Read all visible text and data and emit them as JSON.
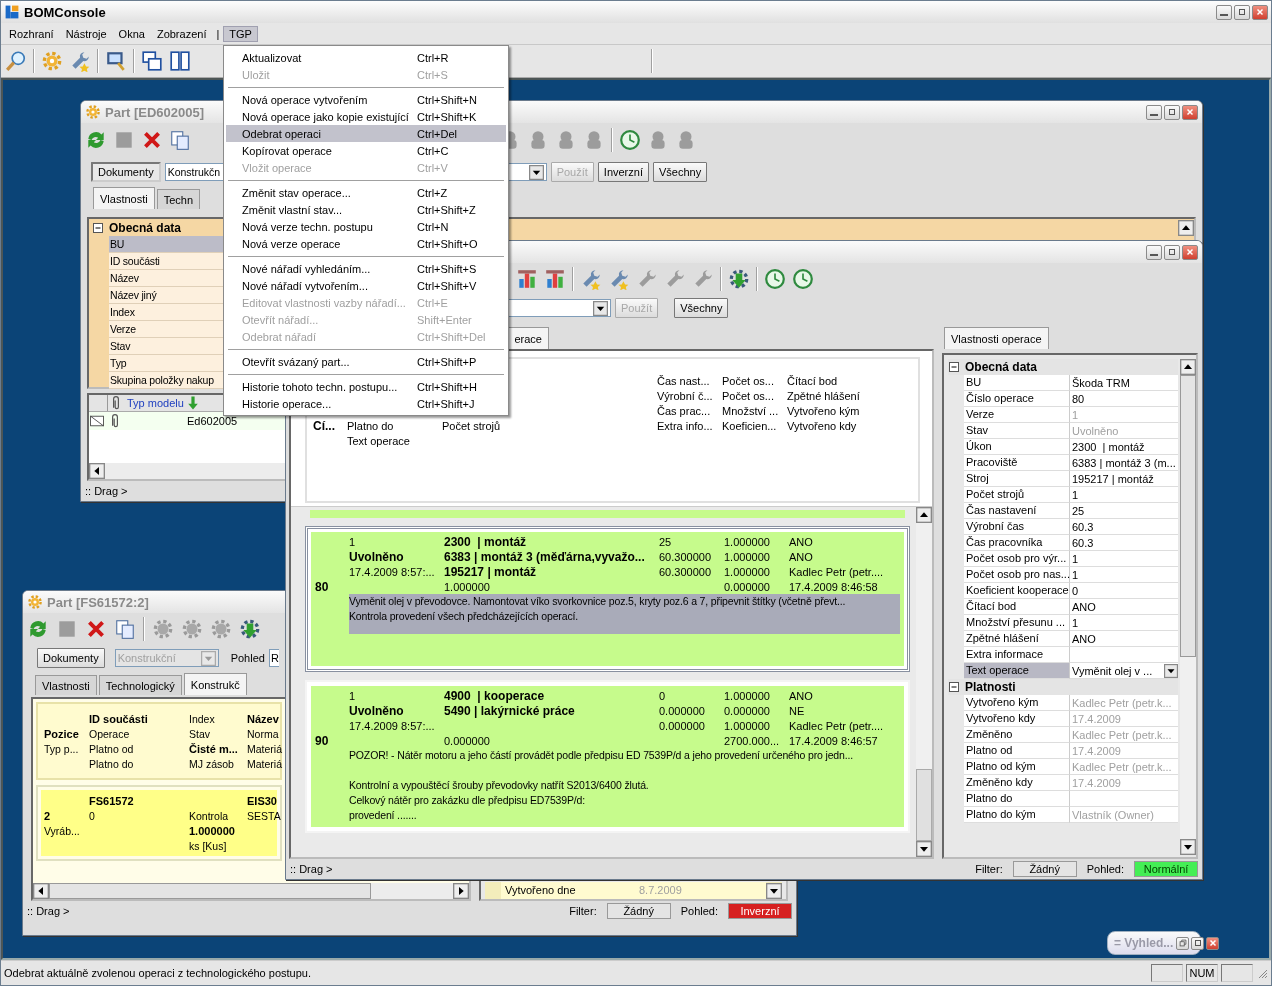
{
  "app": {
    "title": "BOMConsole"
  },
  "menu_bar": [
    {
      "label": "Rozhraní",
      "kind": "menu",
      "selected": false
    },
    {
      "label": "Nástroje",
      "kind": "menu",
      "selected": false
    },
    {
      "label": "Okna",
      "kind": "menu",
      "selected": false
    },
    {
      "label": "Zobrazení",
      "kind": "menu",
      "selected": false
    },
    {
      "label": "|",
      "kind": "divider"
    },
    {
      "label": "TGP",
      "kind": "menu",
      "selected": true
    }
  ],
  "tgp_menu": [
    [
      {
        "label": "Aktualizovat",
        "shortcut": "Ctrl+R",
        "disabled": false,
        "selected": false
      },
      {
        "label": "Uložit",
        "shortcut": "Ctrl+S",
        "disabled": true,
        "selected": false
      }
    ],
    [
      {
        "label": "Nová operace vytvořením",
        "shortcut": "Ctrl+Shift+N",
        "disabled": false,
        "selected": false
      },
      {
        "label": "Nová operace jako kopie existující",
        "shortcut": "Ctrl+Shift+K",
        "disabled": false,
        "selected": false
      },
      {
        "label": "Odebrat operaci",
        "shortcut": "Ctrl+Del",
        "disabled": false,
        "selected": true
      },
      {
        "label": "Kopírovat operace",
        "shortcut": "Ctrl+C",
        "disabled": false,
        "selected": false
      },
      {
        "label": "Vložit operace",
        "shortcut": "Ctrl+V",
        "disabled": true,
        "selected": false
      }
    ],
    [
      {
        "label": "Změnit stav operace...",
        "shortcut": "Ctrl+Z",
        "disabled": false,
        "selected": false
      },
      {
        "label": "Změnit vlastní stav...",
        "shortcut": "Ctrl+Shift+Z",
        "disabled": false,
        "selected": false
      },
      {
        "label": "Nová verze techn. postupu",
        "shortcut": "Ctrl+N",
        "disabled": false,
        "selected": false
      },
      {
        "label": "Nová verze operace",
        "shortcut": "Ctrl+Shift+O",
        "disabled": false,
        "selected": false
      }
    ],
    [
      {
        "label": "Nové nářadí vyhledáním...",
        "shortcut": "Ctrl+Shift+S",
        "disabled": false,
        "selected": false
      },
      {
        "label": "Nové nářadí vytvořením...",
        "shortcut": "Ctrl+Shift+V",
        "disabled": false,
        "selected": false
      },
      {
        "label": "Editovat vlastnosti vazby nářadí...",
        "shortcut": "Ctrl+E",
        "disabled": true,
        "selected": false
      },
      {
        "label": "Otevřít nářadí...",
        "shortcut": "Shift+Enter",
        "disabled": true,
        "selected": false
      },
      {
        "label": "Odebrat nářadí",
        "shortcut": "Ctrl+Shift+Del",
        "disabled": true,
        "selected": false
      }
    ],
    [
      {
        "label": "Otevřít svázaný part...",
        "shortcut": "Ctrl+Shift+P",
        "disabled": false,
        "selected": false
      }
    ],
    [
      {
        "label": "Historie tohoto techn. postupu...",
        "shortcut": "Ctrl+Shift+H",
        "disabled": false,
        "selected": false
      },
      {
        "label": "Historie operace...",
        "shortcut": "Ctrl+Shift+J",
        "disabled": false,
        "selected": false
      }
    ]
  ],
  "part_window_ed602005": {
    "title": "Part [ED602005]",
    "documents_button": "Dokumenty",
    "structure_combo": "Konstrukčn",
    "apply_button": {
      "label": "Použít",
      "disabled": true
    },
    "inverse_button": "Inverzní",
    "all_button": "Všechny",
    "tabs": [
      {
        "label": "Vlastnosti",
        "selected": true
      },
      {
        "label": "Techn",
        "selected": false
      }
    ],
    "properties": {
      "sections": [
        {
          "title": "Obecná data",
          "expanded": true,
          "rows": [
            {
              "label": "BU",
              "selected": true
            },
            {
              "label": "ID součásti",
              "selected": false
            },
            {
              "label": "Název",
              "selected": false
            },
            {
              "label": "Název jiný",
              "selected": false
            },
            {
              "label": "Index",
              "selected": false
            },
            {
              "label": "Verze",
              "selected": false
            },
            {
              "label": "Stav",
              "selected": false
            },
            {
              "label": "Typ",
              "selected": false
            },
            {
              "label": "Skupina položky nakup",
              "selected": false
            }
          ]
        }
      ]
    },
    "models": {
      "columns": [
        "Typ modelu"
      ],
      "rows": [
        {
          "model": "Ed602005"
        }
      ]
    },
    "status": {
      "drag": ":: Drag >"
    }
  },
  "operations_window": {
    "apply_button": {
      "label": "Použít",
      "disabled": true
    },
    "all_button": "Všechny",
    "tabs": [
      {
        "label": "erace",
        "selected": true
      }
    ],
    "header": {
      "lines": [
        {
          "column_4": "Čas nast...",
          "column_5": "Počet os...",
          "column_6": "Čítací bod"
        },
        {
          "column_4": "Výrobní č...",
          "column_5": "Počet os...",
          "column_6": "Zpětné hlášení"
        },
        {
          "column_4": "Čas prac...",
          "column_5": "Množství ...",
          "column_6": "Vytvořeno kým"
        },
        {
          "column_1": {
            "text": "Cí...",
            "bold": true
          },
          "column_2": "Platno do",
          "column_3": "Počet strojů",
          "column_4": "Extra info...",
          "column_5": "Koeficien...",
          "column_6": "Vytvořeno kdy"
        }
      ],
      "text_label": "Text operace"
    },
    "operations": [
      {
        "selected": true,
        "lines": [
          {
            "column_2": "1",
            "column_3": {
              "text": "2300  | montáž",
              "bold": true
            },
            "column_4": "25",
            "column_5": "1.000000",
            "column_6": "ANO"
          },
          {
            "column_2": {
              "text": "Uvolněno",
              "bold": true
            },
            "column_3": {
              "text": "6383 | montáž 3 (měďárna,vyvažo...",
              "bold": true
            },
            "column_4": "60.300000",
            "column_5": "1.000000",
            "column_6": "ANO"
          },
          {
            "column_2": "17.4.2009 8:57:...",
            "column_3": {
              "text": "195217 | montáž",
              "bold": true
            },
            "column_4": "60.300000",
            "column_5": "1.000000",
            "column_6": "Kadlec Petr (petr...."
          },
          {
            "column_1": {
              "text": "80",
              "bold": true
            },
            "column_3": "1.000000",
            "column_5": "0.000000",
            "column_6": "17.4.2009 8:46:58"
          }
        ],
        "text": [
          [
            "Vyměnit olej v převodovce. Namontovat víko svorkovnice poz.5, kryty poz.6 a 7, připevnit štítky (včetně převt...",
            "Kontrola provedení všech předcházejících operací."
          ]
        ]
      },
      {
        "selected": false,
        "lines": [
          {
            "column_2": "1",
            "column_3": {
              "text": "4900  | kooperace",
              "bold": true
            },
            "column_4": "0",
            "column_5": "1.000000",
            "column_6": "ANO"
          },
          {
            "column_2": {
              "text": "Uvolněno",
              "bold": true
            },
            "column_3": {
              "text": "5490 | lakýrnické práce",
              "bold": true
            },
            "column_4": "0.000000",
            "column_5": "0.000000",
            "column_6": "NE"
          },
          {
            "column_2": "17.4.2009 8:57:...",
            "column_4": "0.000000",
            "column_5": "1.000000",
            "column_6": "Kadlec Petr (petr...."
          },
          {
            "column_1": {
              "text": "90",
              "bold": true
            },
            "column_3": "0.000000",
            "column_5": "2700.000...",
            "column_6": "17.4.2009 8:46:57"
          }
        ],
        "text": [
          [
            "POZOR! - Nátěr motoru a jeho částí provádět podle předpisu ED 7539P/d a jeho provedení určeného pro jedn..."
          ],
          [
            "Kontrolní a vypouštěcí šrouby převodovky natřít S2013/6400 žlutá.",
            "Celkový nátěr pro zakázku dle předpisu ED7539P/d:",
            "provedení ......."
          ]
        ]
      }
    ],
    "properties_tab": {
      "label": "Vlastnosti operace",
      "selected": true
    },
    "properties": {
      "sections": [
        {
          "title": "Obecná data",
          "expanded": true,
          "rows": [
            {
              "label": "BU",
              "value": "Škoda TRM",
              "disabled": false,
              "selected": false
            },
            {
              "label": "Číslo operace",
              "value": "80",
              "disabled": false,
              "selected": false
            },
            {
              "label": "Verze",
              "value": "1",
              "disabled": true,
              "selected": false
            },
            {
              "label": "Stav",
              "value": "Uvolněno",
              "disabled": true,
              "selected": false
            },
            {
              "label": "Úkon",
              "value": "2300  | montáž",
              "disabled": false,
              "selected": false
            },
            {
              "label": "Pracoviště",
              "value": "6383 | montáž 3 (m...",
              "disabled": false,
              "selected": false
            },
            {
              "label": "Stroj",
              "value": "195217 | montáž",
              "disabled": false,
              "selected": false
            },
            {
              "label": "Počet strojů",
              "value": "1",
              "disabled": false,
              "selected": false
            },
            {
              "label": "Čas nastavení",
              "value": "25",
              "disabled": false,
              "selected": false
            },
            {
              "label": "Výrobní čas",
              "value": "60.3",
              "disabled": false,
              "selected": false
            },
            {
              "label": "Čas pracovníka",
              "value": "60.3",
              "disabled": false,
              "selected": false
            },
            {
              "label": "Počet osob pro výr...",
              "value": "1",
              "disabled": false,
              "selected": false
            },
            {
              "label": "Počet osob pro nas...",
              "value": "1",
              "disabled": false,
              "selected": false
            },
            {
              "label": "Koeficient kooperace",
              "value": "0",
              "disabled": false,
              "selected": false
            },
            {
              "label": "Čítací bod",
              "value": "ANO",
              "disabled": false,
              "selected": false
            },
            {
              "label": "Množství přesunu ...",
              "value": "1",
              "disabled": false,
              "selected": false
            },
            {
              "label": "Zpětné hlášení",
              "value": "ANO",
              "disabled": false,
              "selected": false
            },
            {
              "label": "Extra informace",
              "selected": false
            },
            {
              "label": "Text operace",
              "value": "Vyměnit olej v ...",
              "kind": "dropdown",
              "disabled": false,
              "selected": true
            }
          ]
        },
        {
          "title": "Platnosti",
          "expanded": true,
          "rows": [
            {
              "label": "Vytvořeno kým",
              "value": "Kadlec Petr (petr.k...",
              "disabled": true,
              "selected": false
            },
            {
              "label": "Vytvořeno kdy",
              "value": "17.4.2009",
              "disabled": true,
              "selected": false
            },
            {
              "label": "Změněno",
              "value": "Kadlec Petr (petr.k...",
              "disabled": true,
              "selected": false
            },
            {
              "label": "Platno od",
              "value": "17.4.2009",
              "disabled": true,
              "selected": false
            },
            {
              "label": "Platno od kým",
              "value": "Kadlec Petr (petr.k...",
              "disabled": true,
              "selected": false
            },
            {
              "label": "Změněno kdy",
              "value": "17.4.2009",
              "disabled": true,
              "selected": false
            },
            {
              "label": "Platno do",
              "selected": false
            },
            {
              "label": "Platno do kým",
              "value": "Vlastník (Owner)",
              "disabled": true,
              "selected": false
            }
          ]
        }
      ]
    },
    "status": {
      "drag": ":: Drag >",
      "filter_label": "Filter:",
      "filter": "Žádný",
      "view_label": "Pohled:",
      "view": {
        "label": "Normální",
        "kind": "normal"
      }
    }
  },
  "part_window_fs61572": {
    "title": "Part [FS61572:2]",
    "documents_button": "Dokumenty",
    "structure_combo": {
      "value": "Konstrukční",
      "disabled": true
    },
    "view_label": "Pohled",
    "view_combo": "R",
    "tabs": [
      {
        "label": "Vlastnosti",
        "selected": false
      },
      {
        "label": "Technologický",
        "selected": false
      },
      {
        "label": "Konstrukč",
        "selected": true
      }
    ],
    "header": {
      "lines": [
        {
          "column_2": {
            "text": "ID součásti",
            "bold": true
          },
          "column_3": "Index",
          "column_4": {
            "text": "Název",
            "bold": true
          }
        },
        {
          "column_1": {
            "text": "Pozice",
            "bold": true
          },
          "column_2": "Operace",
          "column_3": "Stav",
          "column_4": "Norma"
        },
        {
          "column_1": "Typ p...",
          "column_2": "Platno od",
          "column_3": {
            "text": "Čisté m...",
            "bold": true
          },
          "column_4": "Materiá"
        },
        {
          "column_2": "Platno do",
          "column_3": "MJ zásob",
          "column_4": "Materiá"
        }
      ]
    },
    "items": [
      {
        "lines": [
          {
            "column_2": {
              "text": "FS61572",
              "bold": true
            },
            "column_4": {
              "text": "EIS30",
              "bold": true
            }
          },
          {
            "column_1": {
              "text": "2",
              "bold": true
            },
            "column_2": "0",
            "column_3": "Kontrola",
            "column_4": "SESTA"
          },
          {
            "column_1": "Vyráb...",
            "column_3": {
              "text": "1.000000",
              "bold": true
            }
          },
          {
            "column_3": "ks [Kus]"
          }
        ]
      }
    ],
    "details_row": {
      "label": "Vytvořeno dne",
      "value": "8.7.2009",
      "disabled": true
    },
    "status": {
      "drag": ":: Drag >",
      "filter_label": "Filter:",
      "filter": "Žádný",
      "view_label": "Pohled:",
      "view": {
        "label": "Inverzní",
        "kind": "inverse"
      }
    }
  },
  "minimized_window": {
    "title": "= Vyhled..."
  },
  "status_bar": {
    "message": "Odebrat aktuálně zvolenou operaci z technologického postupu.",
    "num_indicator": "NUM"
  }
}
